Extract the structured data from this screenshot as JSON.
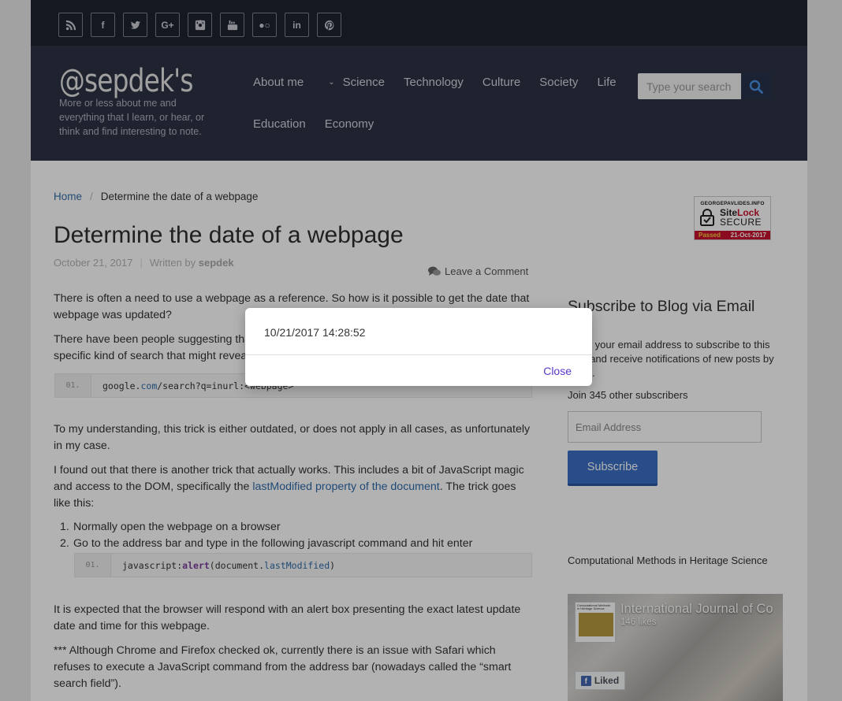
{
  "social": [
    {
      "icon": "rss-icon",
      "glyph": ""
    },
    {
      "icon": "facebook-icon",
      "glyph": "f"
    },
    {
      "icon": "twitter-icon",
      "glyph": ""
    },
    {
      "icon": "google-plus-icon",
      "glyph": "G+"
    },
    {
      "icon": "instagram-icon",
      "glyph": ""
    },
    {
      "icon": "youtube-icon",
      "glyph": ""
    },
    {
      "icon": "flickr-icon",
      "glyph": "●○"
    },
    {
      "icon": "linkedin-icon",
      "glyph": "in"
    },
    {
      "icon": "pinterest-icon",
      "glyph": ""
    }
  ],
  "header": {
    "logo": "@sepdek's",
    "tagline": "More or less about me and everything that I learn, or hear, or think and find interesting to note.",
    "nav_row1": [
      "About me",
      "Science",
      "Technology",
      "Culture",
      "Society",
      "Life"
    ],
    "nav_row2": [
      "Education",
      "Economy"
    ],
    "search_placeholder": "Type your search"
  },
  "breadcrumb": {
    "home": "Home",
    "sep": "/",
    "current": "Determine the date of a webpage"
  },
  "post": {
    "title": "Determine the date of a webpage",
    "date": "October 21, 2017",
    "written_by": "Written by",
    "author": "sepdek",
    "comment_link": "Leave a Comment",
    "p1": "There is often a need to use a webpage as a reference. So how is it possible to get the date that webpage was updated?",
    "p2": "There have been people suggesting that one could search in Google for the webpage with a specific kind of search that might reveal the date:",
    "code1": {
      "ln": "01.",
      "pre": "google.",
      "kw": "com",
      "post": "/search?q=inurl:<webpage>"
    },
    "p3": "To my understanding, this trick is either outdated, or does not apply in all cases, as unfortunately in my case.",
    "p4_pre": "I found out that there is another trick that actually works. This includes a bit of JavaScript magic and access to the DOM, specifically the ",
    "p4_link": "lastModified property of the document",
    "p4_post": ". The trick goes like this:",
    "steps": [
      {
        "n": "1.",
        "text": "Normally open the webpage on a browser"
      },
      {
        "n": "2.",
        "text": "Go to the address bar and type in the following javascript command and hit enter"
      }
    ],
    "code2": {
      "ln": "01.",
      "a": "javascript:",
      "fn": "alert",
      "b": "(document.",
      "kw": "lastModified",
      "c": ")"
    },
    "p5": "It is expected that the browser will respond with an alert box presenting the exact latest update date and time for this webpage.",
    "p6": "*** Although Chrome and Firefox checked ok, currently there is an issue with Safari which refuses to execute a JavaScript command from the address bar (nowadays called the “smart search field”)."
  },
  "sidebar": {
    "sitelock": {
      "domain": "GEORGEPAVLIDES.INFO",
      "brand_a": "Site",
      "brand_b": "Lock",
      "secure": "SECURE",
      "passed": "Passed",
      "date": "21-Oct-2017"
    },
    "subscribe_title": "Subscribe to Blog via Email",
    "subscribe_text": "Enter your email address to subscribe to this blog and receive notifications of new posts by email.",
    "join": "Join 345 other subscribers",
    "email_placeholder": "Email Address",
    "subscribe_button": "Subscribe",
    "cm_title": "Computational Methods in Heritage Science",
    "fb": {
      "thumb_text": "Computational Methods in Heritage Science",
      "name": "International Journal of Co",
      "likes": "146 likes",
      "liked": "Liked"
    }
  },
  "modal": {
    "message": "10/21/2017 14:28:52",
    "close": "Close"
  }
}
